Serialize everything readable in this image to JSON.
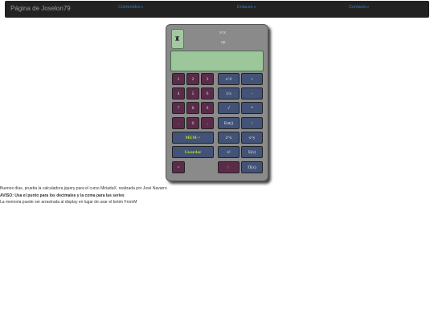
{
  "navbar": {
    "brand": "Página de Joselon79",
    "links": [
      "Contenidos",
      "Enlaces",
      "Contacto"
    ]
  },
  "calculator": {
    "expression_readout": "x<x",
    "operation_readout": "op",
    "display_value": "",
    "keys": {
      "n1": "1",
      "n2": "2",
      "n3": "3",
      "n4": "4",
      "n5": "5",
      "n6": "6",
      "n7": "7",
      "n8": "8",
      "n9": "9",
      "dot": ".",
      "n0": "0",
      "comma": ",",
      "eq": "=",
      "square": "x^2",
      "plus": "+",
      "inv": "1/x",
      "minus": "-",
      "sqrt": "√",
      "mult": "*",
      "ent": "Ent()",
      "div": "/",
      "pow2x": "2^x",
      "powxy": "x^y",
      "fact": "x!",
      "sum": "Σ(x)",
      "clear": "C",
      "prod": "Π(x)",
      "mem": "MEM->",
      "save": "Guardar"
    }
  },
  "info": {
    "line1": "Buenos días, prueba la calculadora jquery para el curso MiriadaX, realizada por José Navarro",
    "line2": "AVISO: Usa el punto para los decimales y la coma para las series",
    "line3": "La memoria puede ser arrastrada al display en lugar de usar el botón FromM"
  },
  "colors": {
    "navbar": "#222222",
    "link": "#337ab7",
    "display": "#9bc79b",
    "number_key": "#5b2c4a",
    "function_key": "#425377",
    "accent_green": "#b8d832",
    "clear_red": "#ff2e2e"
  },
  "icons": {
    "drag_handle": "robot-icon"
  }
}
